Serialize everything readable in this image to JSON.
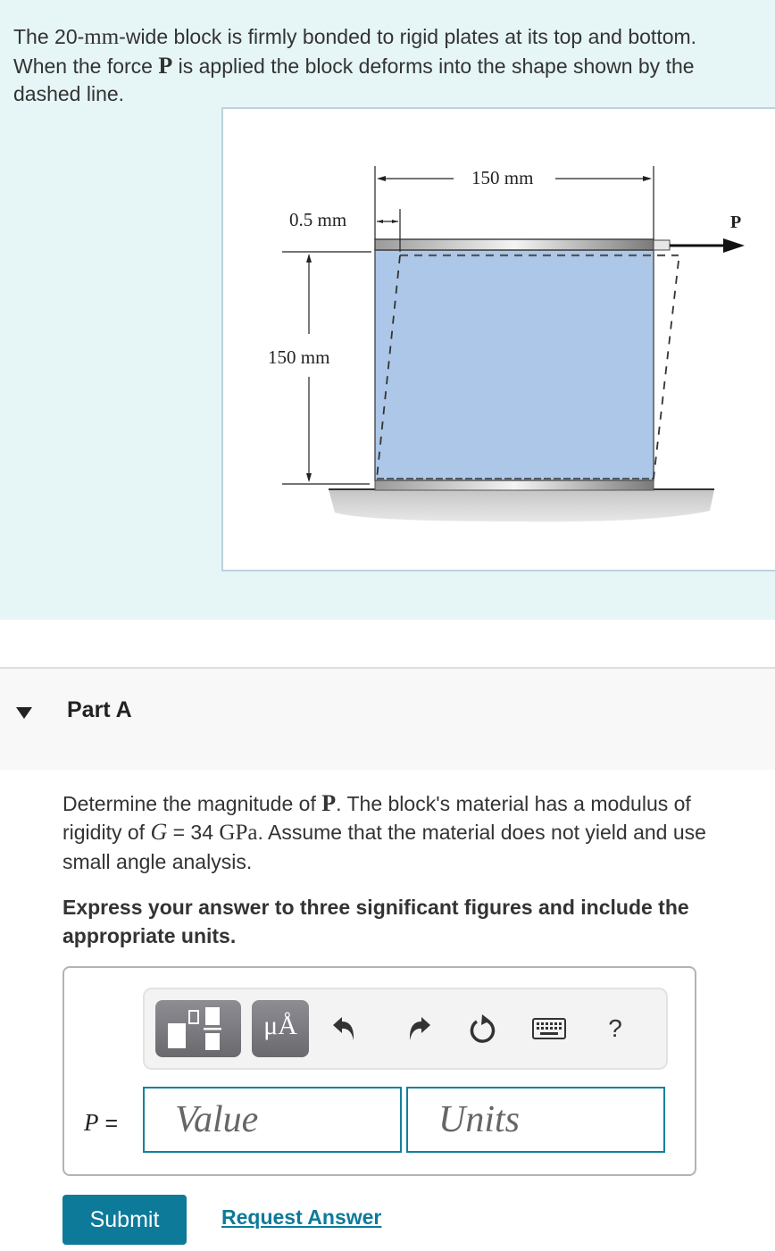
{
  "intro": {
    "line1_pre": "The 20-",
    "line1_unit": "mm",
    "line1_post": "-wide block is firmly bonded to rigid plates at its top and bottom.",
    "line2_pre": "When the force ",
    "line2_symbol": "P",
    "line2_post": " is applied the block deforms into the shape shown by the",
    "line3": "dashed line."
  },
  "figure": {
    "width_label": "150 mm",
    "height_label": "150 mm",
    "displacement_label": "0.5 mm",
    "force_label": "P",
    "colors": {
      "block_fill": "#adc7e8",
      "ground_fill": "#cfcfcf",
      "line": "#222222"
    }
  },
  "part": {
    "title": "Part A",
    "expanded": true
  },
  "question": {
    "line1_pre": "Determine the magnitude of ",
    "line1_symbol": "P",
    "line1_post": ". The block's material has a modulus of",
    "line2_pre": "rigidity of ",
    "line2_var": "G",
    "line2_eq": " = 34 ",
    "line2_unit": "GPa",
    "line2_post": ". Assume that the material does not yield and use",
    "line3": "small angle analysis."
  },
  "instructions": {
    "line1": "Express your answer to three significant figures and include the",
    "line2": "appropriate units."
  },
  "answer": {
    "variable": "P",
    "equals": "=",
    "value_placeholder": "Value",
    "units_placeholder": "Units",
    "value": "",
    "units": ""
  },
  "toolbar": {
    "templates_icon": "templates-icon",
    "units_label": "μÅ",
    "undo_icon": "undo-icon",
    "redo_icon": "redo-icon",
    "reset_icon": "reset-icon",
    "keyboard_icon": "keyboard-icon",
    "help_label": "?"
  },
  "actions": {
    "submit_label": "Submit",
    "request_answer_label": "Request Answer"
  },
  "colors": {
    "accent": "#0d7a9a",
    "intro_bg": "#e6f5f6",
    "part_header_bg": "#f8f8f8"
  }
}
